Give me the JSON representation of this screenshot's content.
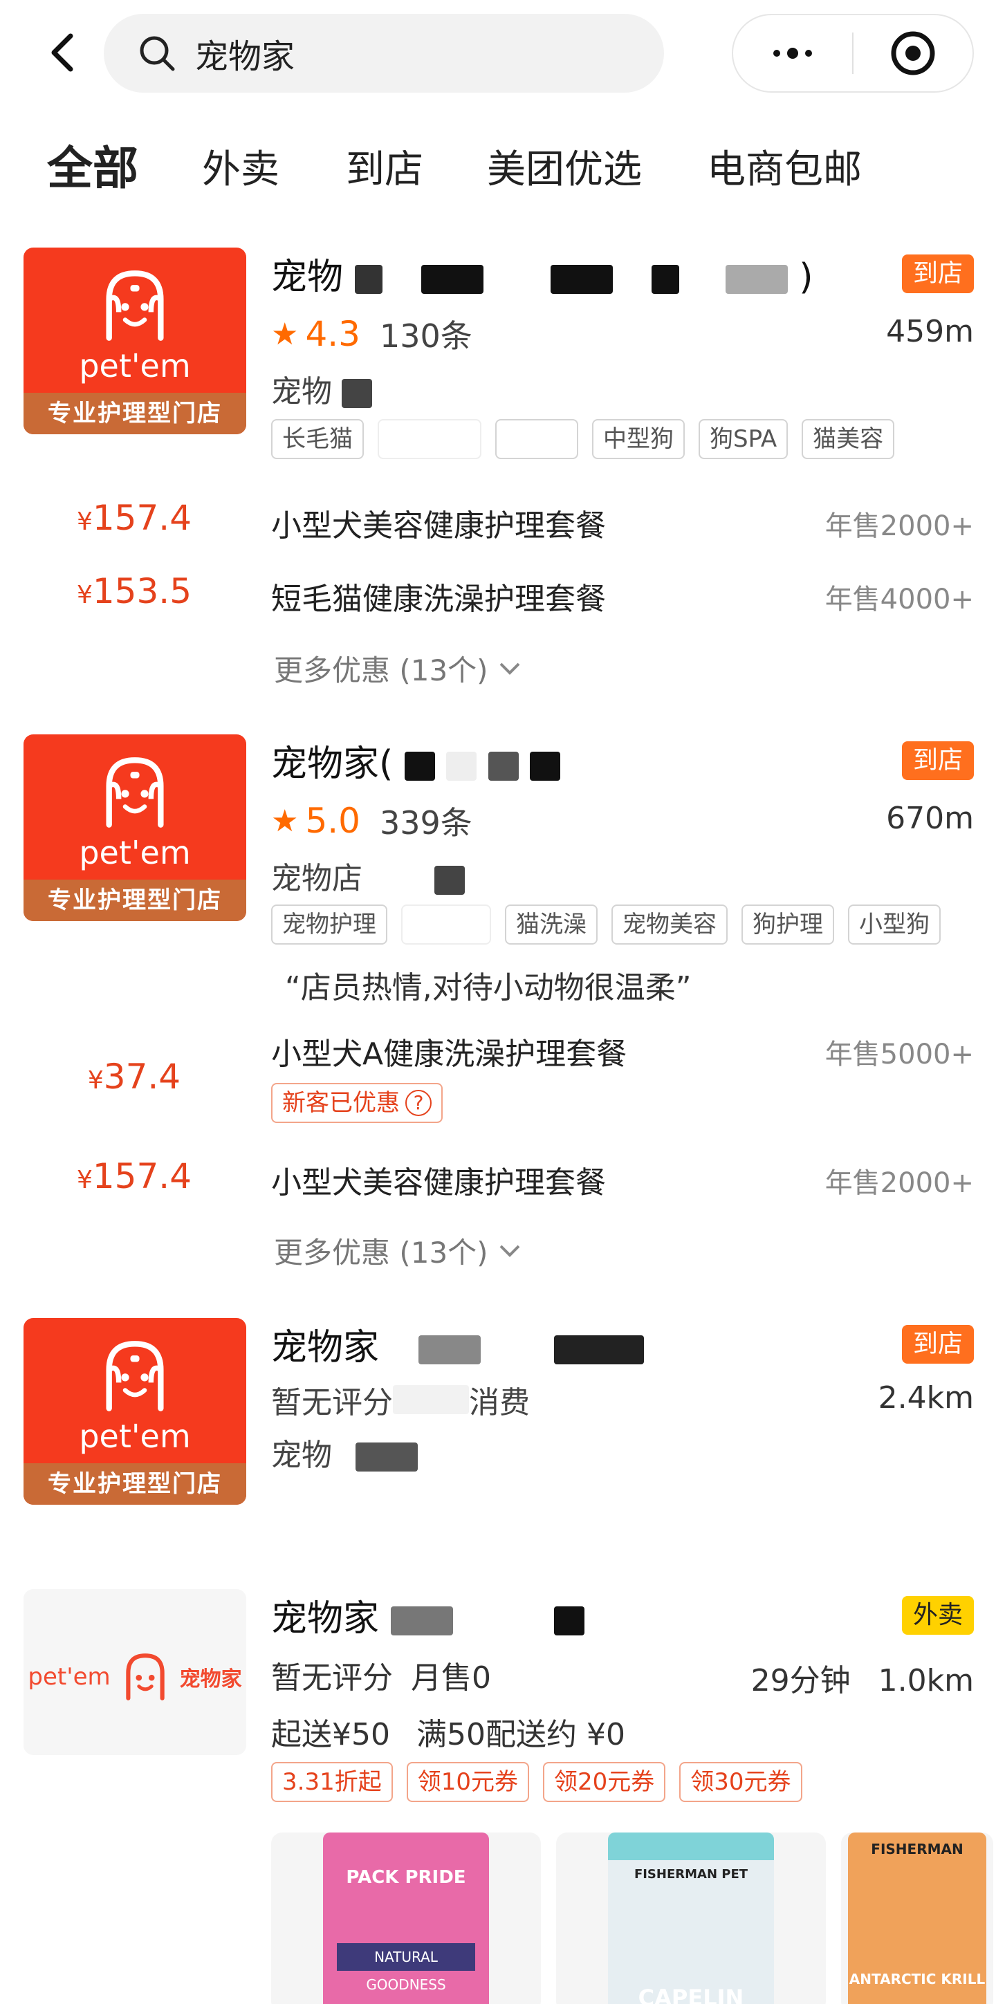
{
  "search": {
    "query": "宠物家"
  },
  "tabs": [
    "全部",
    "外卖",
    "到店",
    "美团优选",
    "电商包邮"
  ],
  "colors": {
    "accent": "#ff6f1e",
    "price": "#e5421c",
    "star": "#ff6a00",
    "tab_underline": "#ffd100",
    "logo_bg": "#f53a1e"
  },
  "shops": [
    {
      "logo": {
        "brand": "专业护理型门店",
        "text": "pet'em"
      },
      "title": "宠物",
      "title_suffix": ")",
      "badge": "到店",
      "rating": "4.3",
      "reviews": "130条",
      "distance": "459m",
      "category": "宠物",
      "tags": [
        "长毛猫",
        "中型狗",
        "狗SPA",
        "猫美容"
      ],
      "deals": [
        {
          "price": "157.4",
          "name": "小型犬美容健康护理套餐",
          "sold": "年售2000+"
        },
        {
          "price": "153.5",
          "name": "短毛猫健康洗澡护理套餐",
          "sold": "年售4000+"
        }
      ],
      "more": "更多优惠 (13个)"
    },
    {
      "logo": {
        "brand": "专业护理型门店",
        "text": "pet'em"
      },
      "title": "宠物家(",
      "badge": "到店",
      "rating": "5.0",
      "reviews": "339条",
      "distance": "670m",
      "category": "宠物店",
      "tags": [
        "宠物护理",
        "猫洗澡",
        "宠物美容",
        "狗护理",
        "小型狗"
      ],
      "quote": "“店员热情,对待小动物很温柔”",
      "deals": [
        {
          "price": "37.4",
          "name": "小型犬A健康洗澡护理套餐",
          "sold": "年售5000+",
          "promo": "新客已优惠"
        },
        {
          "price": "157.4",
          "name": "小型犬美容健康护理套餐",
          "sold": "年售2000+"
        }
      ],
      "more": "更多优惠 (13个)"
    },
    {
      "logo": {
        "brand": "专业护理型门店",
        "text": "pet'em"
      },
      "title": "宠物家",
      "badge": "到店",
      "rating_text": "暂无评分",
      "consume_text": "消费",
      "distance": "2.4km",
      "category": "宠物"
    },
    {
      "logo": {
        "text": "pet'em",
        "cn": "宠物家"
      },
      "title": "宠物家",
      "badge": "外卖",
      "rating_text": "暂无评分",
      "monthly": "月售0",
      "eta": "29分钟",
      "distance": "1.0km",
      "min_order": "起送¥50",
      "delivery": "满50配送约 ¥0",
      "coupons": [
        "3.31折起",
        "领10元券",
        "领20元券",
        "领30元券"
      ],
      "products": [
        {
          "label": "PACK PRIDE",
          "sub": "NATURAL GOODNESS"
        },
        {
          "label": "FISHERMAN PET",
          "sub": "CAPELIN"
        },
        {
          "label": "FISHERMAN",
          "sub": "ANTARCTIC KRILL"
        }
      ]
    }
  ],
  "currency": "¥"
}
